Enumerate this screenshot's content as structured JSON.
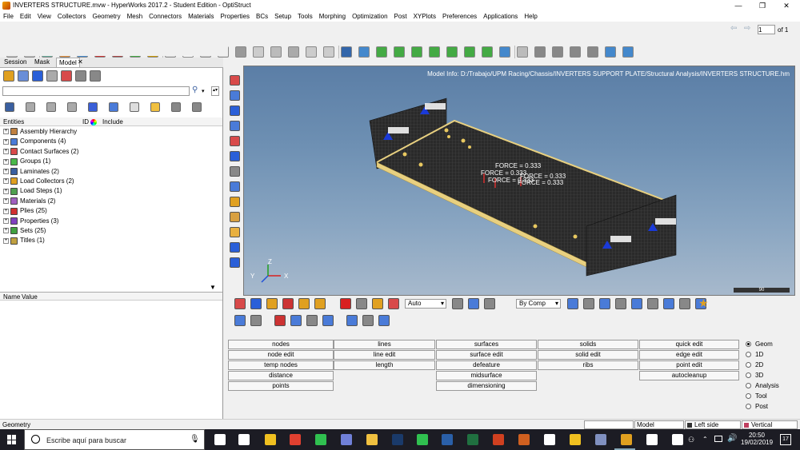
{
  "window": {
    "title": "INVERTERS STRUCTURE.mvw - HyperWorks 2017.2 - Student Edition - OptiStruct",
    "minimize": "—",
    "maximize": "❐",
    "close": "✕"
  },
  "menu": [
    "File",
    "Edit",
    "View",
    "Collectors",
    "Geometry",
    "Mesh",
    "Connectors",
    "Materials",
    "Properties",
    "BCs",
    "Setup",
    "Tools",
    "Morphing",
    "Optimization",
    "Post",
    "XYPlots",
    "Preferences",
    "Applications",
    "Help"
  ],
  "page_nav": {
    "value": "1",
    "of_label": "of 1"
  },
  "left_panel": {
    "tabs": [
      "Session",
      "Mask",
      "Model"
    ],
    "close_glyph": "✕",
    "columns": {
      "entities": "Entities",
      "id": "ID",
      "include": "Include"
    },
    "tree": [
      {
        "label": "Assembly Hierarchy",
        "color": "#c08040"
      },
      {
        "label": "Components (4)",
        "color": "#4a7bd8"
      },
      {
        "label": "Contact Surfaces (2)",
        "color": "#d84a4a"
      },
      {
        "label": "Groups (1)",
        "color": "#4ab84a"
      },
      {
        "label": "Laminates (2)",
        "color": "#3a5fa0"
      },
      {
        "label": "Load Collectors (2)",
        "color": "#e0a020"
      },
      {
        "label": "Load Steps (1)",
        "color": "#50a050"
      },
      {
        "label": "Materials (2)",
        "color": "#a060c0"
      },
      {
        "label": "Plies (25)",
        "color": "#d03030"
      },
      {
        "label": "Properties (3)",
        "color": "#8040c0"
      },
      {
        "label": "Sets (25)",
        "color": "#40a040"
      },
      {
        "label": "Titles (1)",
        "color": "#c0a040"
      }
    ],
    "name_value": {
      "name": "Name",
      "value": "Value"
    }
  },
  "viewport": {
    "model_info": "Model Info: D:/Trabajo/UPM Racing/Chassis/INVERTERS SUPPORT PLATE/Structural Analysis/INVERTERS STRUCTURE.hm",
    "force_labels": [
      "FORCE = 0.333",
      "FORCE = 0.333",
      "FORCE = 0.333",
      "FORCE = 0.333",
      "FORCE = 0.333"
    ],
    "axis": {
      "x": "X",
      "y": "Y",
      "z": "Z"
    },
    "scale": "90"
  },
  "lower_toolbar": {
    "auto_select": "Auto",
    "by_comp_select": "By Comp"
  },
  "panel_buttons": [
    [
      "nodes",
      "lines",
      "surfaces",
      "solids",
      "quick edit"
    ],
    [
      "node edit",
      "line edit",
      "surface edit",
      "solid edit",
      "edge edit"
    ],
    [
      "temp nodes",
      "length",
      "defeature",
      "ribs",
      "point edit"
    ],
    [
      "distance",
      "",
      "midsurface",
      "",
      "autocleanup"
    ],
    [
      "points",
      "",
      "dimensioning",
      "",
      ""
    ]
  ],
  "radio_options": [
    {
      "label": "Geom",
      "selected": true
    },
    {
      "label": "1D",
      "selected": false
    },
    {
      "label": "2D",
      "selected": false
    },
    {
      "label": "3D",
      "selected": false
    },
    {
      "label": "Analysis",
      "selected": false
    },
    {
      "label": "Tool",
      "selected": false
    },
    {
      "label": "Post",
      "selected": false
    }
  ],
  "status": {
    "message": "Geometry",
    "model": "Model",
    "component": "Left side support",
    "load": "Vertical"
  },
  "taskbar": {
    "search_placeholder": "Escribe aquí para buscar",
    "time": "20:50",
    "date": "19/02/2019",
    "notification_count": "17"
  }
}
